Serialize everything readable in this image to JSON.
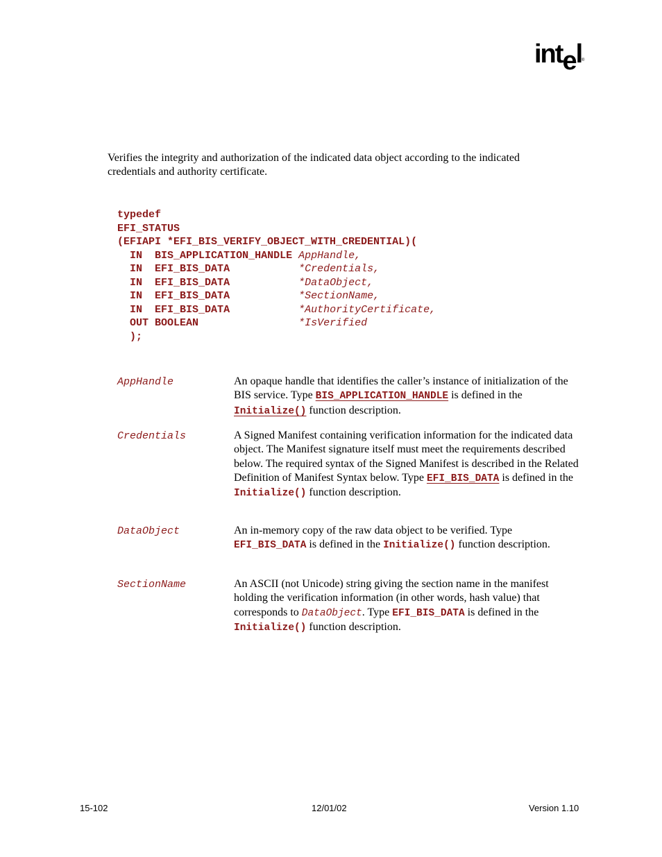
{
  "header": {
    "logo_text_main": "int",
    "logo_text_e": "e",
    "logo_text_l": "l",
    "logo_reg": "®"
  },
  "summary": "Verifies the integrity and authorization of the indicated data object according to the indicated credentials and authority certificate.",
  "prototype": {
    "line1": "typedef",
    "line2": "EFI_STATUS",
    "line3": "(EFIAPI *EFI_BIS_VERIFY_OBJECT_WITH_CREDENTIAL)(",
    "args": [
      {
        "dir": "IN ",
        "type": "BIS_APPLICATION_HANDLE ",
        "name": "AppHandle,"
      },
      {
        "dir": "IN ",
        "type": "EFI_BIS_DATA           ",
        "name": "*Credentials,"
      },
      {
        "dir": "IN ",
        "type": "EFI_BIS_DATA           ",
        "name": "*DataObject,"
      },
      {
        "dir": "IN ",
        "type": "EFI_BIS_DATA           ",
        "name": "*SectionName,"
      },
      {
        "dir": "IN ",
        "type": "EFI_BIS_DATA           ",
        "name": "*AuthorityCertificate,"
      },
      {
        "dir": "OUT",
        "type": "BOOLEAN                ",
        "name": "*IsVerified"
      }
    ],
    "close": ");"
  },
  "parameters": [
    {
      "name": "AppHandle",
      "parts": [
        "An opaque handle that identifies the caller’s instance of initialization of the BIS service.  Type ",
        "BIS_APPLICATION_HANDLE",
        " is defined in the ",
        "Initialize()",
        " function description."
      ]
    },
    {
      "name": "Credentials",
      "parts": [
        "A Signed Manifest containing verification information for the indicated data object.  The Manifest signature itself must meet the requirements described below.  The required syntax of the Signed Manifest is described in the Related Definition of Manifest Syntax below.  Type ",
        "EFI_BIS_DATA",
        " is defined in the ",
        "Initialize()",
        " function description."
      ]
    },
    {
      "name": "DataObject",
      "parts": [
        "An in-memory copy of the raw data object to be verified.  Type ",
        "EFI_BIS_DATA",
        " is defined in the ",
        "Initialize()",
        " function description."
      ]
    },
    {
      "name": "SectionName",
      "parts": [
        "An ASCII (not Unicode) string giving the section name in the manifest holding the verification information (in other words, hash value) that corresponds to ",
        "DataObject",
        ".  Type ",
        "EFI_BIS_DATA",
        " is defined in the ",
        "Initialize()",
        " function description."
      ]
    }
  ],
  "footer": {
    "page": "15-102",
    "date": "12/01/02",
    "version": "Version 1.10"
  },
  "colors": {
    "code": "#8b1a1a",
    "text": "#000000"
  }
}
